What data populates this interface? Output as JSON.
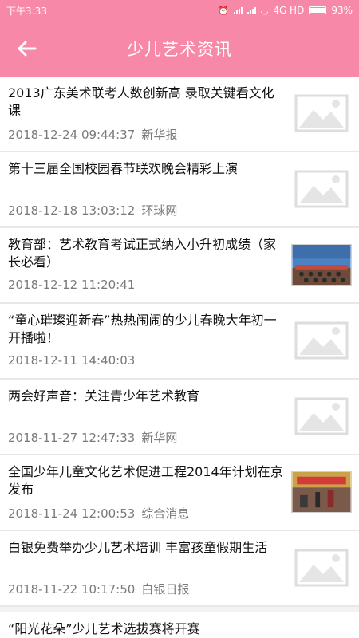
{
  "status": {
    "time": "下午3:33",
    "network": "4G HD",
    "battery": "93%"
  },
  "appbar": {
    "title": "少儿艺术资讯",
    "back_icon": "arrow-left-icon"
  },
  "news": [
    {
      "title": "2013广东美术联考人数创新高 录取关键看文化课",
      "date": "2018-12-24 09:44:37",
      "source": "新华报",
      "thumb": "placeholder"
    },
    {
      "title": "第十三届全国校园春节联欢晚会精彩上演",
      "date": "2018-12-18 13:03:12",
      "source": "环球网",
      "thumb": "placeholder"
    },
    {
      "title": "教育部：艺术教育考试正式纳入小升初成绩（家长必看）",
      "date": "2018-12-12 11:20:41",
      "source": "",
      "thumb": "photo-conference"
    },
    {
      "title": "“童心璀璨迎新春”热热闹闹的少儿春晚大年初一开播啦！",
      "date": "2018-12-11 14:40:03",
      "source": "",
      "thumb": "placeholder"
    },
    {
      "title": "两会好声音：关注青少年艺术教育",
      "date": "2018-11-27 12:47:33",
      "source": "新华网",
      "thumb": "placeholder"
    },
    {
      "title": "全国少年儿童文化艺术促进工程2014年计划在京发布",
      "date": "2018-11-24 12:00:53",
      "source": "综合消息",
      "thumb": "photo-event"
    },
    {
      "title": "白银免费举办少儿艺术培训 丰富孩童假期生活",
      "date": "2018-11-22 10:17:50",
      "source": "白银日报",
      "thumb": "placeholder"
    }
  ],
  "partial_item": {
    "title": "“阳光花朵”少儿艺术选拔赛将开赛"
  },
  "colors": {
    "accent": "#f788a8",
    "meta": "#7a7a7a"
  }
}
